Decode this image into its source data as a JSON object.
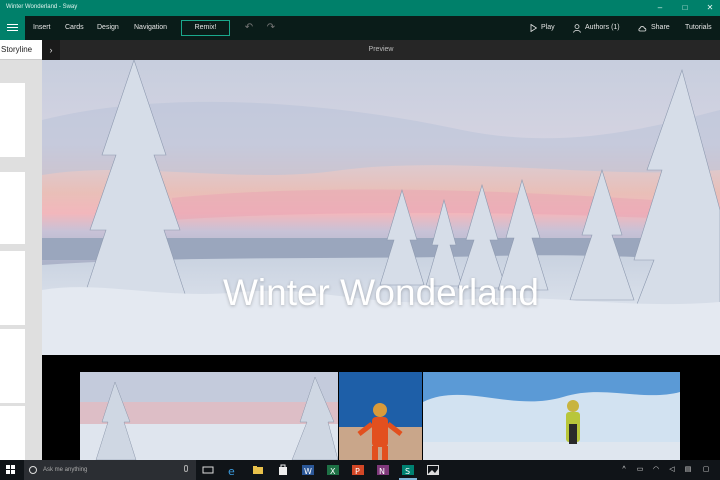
{
  "window": {
    "title": "Winter Wonderland - Sway",
    "controls": [
      "minimize-icon",
      "maximize-icon",
      "close-icon"
    ]
  },
  "ribbon": {
    "menu": [
      "Insert",
      "Cards",
      "Design",
      "Navigation"
    ],
    "remix_label": "Remix!",
    "play_label": "Play",
    "authors_label": "Authors (1)",
    "share_label": "Share",
    "tutorials_label": "Tutorials",
    "accent": "#00806a"
  },
  "storyline": {
    "label": "Storyline"
  },
  "preview": {
    "header_label": "Preview",
    "hero_title": "Winter Wonderland"
  },
  "taskbar": {
    "search_placeholder": "Ask me anything",
    "pinned": [
      "task-view-icon",
      "edge-icon",
      "file-explorer-icon",
      "store-icon",
      "word-icon",
      "excel-icon",
      "powerpoint-icon",
      "onenote-icon",
      "sway-icon",
      "photos-icon"
    ]
  }
}
